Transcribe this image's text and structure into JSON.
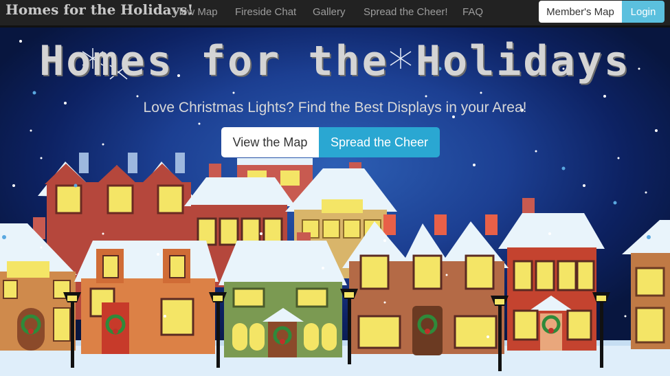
{
  "nav": {
    "brand": "Homes for the Holidays!",
    "links": [
      "View Map",
      "Fireside Chat",
      "Gallery",
      "Spread the Cheer!",
      "FAQ"
    ],
    "member_button": "Member's Map",
    "login_button": "Login"
  },
  "hero": {
    "title": "Homes for the Holidays",
    "subtitle": "Love Christmas Lights? Find the Best Displays in your Area!",
    "map_button": "View the Map",
    "cheer_button": "Spread the Cheer"
  },
  "colors": {
    "navbar": "#222222",
    "accent": "#5bc0de",
    "cheer": "#2aa7d2",
    "sky": "#1c3f92"
  }
}
